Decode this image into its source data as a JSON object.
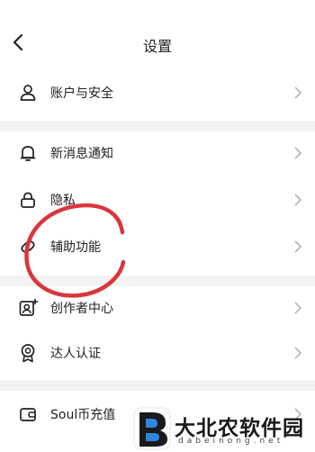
{
  "header": {
    "title": "设置",
    "back_icon": "chevron-left-icon"
  },
  "menu": [
    {
      "id": "account",
      "label": "账户与安全",
      "icon": "user-icon"
    },
    {
      "id": "notify",
      "label": "新消息通知",
      "icon": "bell-icon"
    },
    {
      "id": "privacy",
      "label": "隐私",
      "icon": "lock-icon"
    },
    {
      "id": "assist",
      "label": "辅助功能",
      "icon": "link-icon"
    },
    {
      "id": "creator",
      "label": "创作者中心",
      "icon": "creator-icon"
    },
    {
      "id": "talent",
      "label": "达人认证",
      "icon": "badge-icon"
    },
    {
      "id": "recharge",
      "label": "Soul币充值",
      "icon": "wallet-icon"
    }
  ],
  "watermark": {
    "title": "大北农软件园",
    "subtitle": "dabeinong.net"
  },
  "colors": {
    "annotation_circle": "#d9363e",
    "divider": "#f3f3f3",
    "chevron": "#b5b5b5"
  }
}
